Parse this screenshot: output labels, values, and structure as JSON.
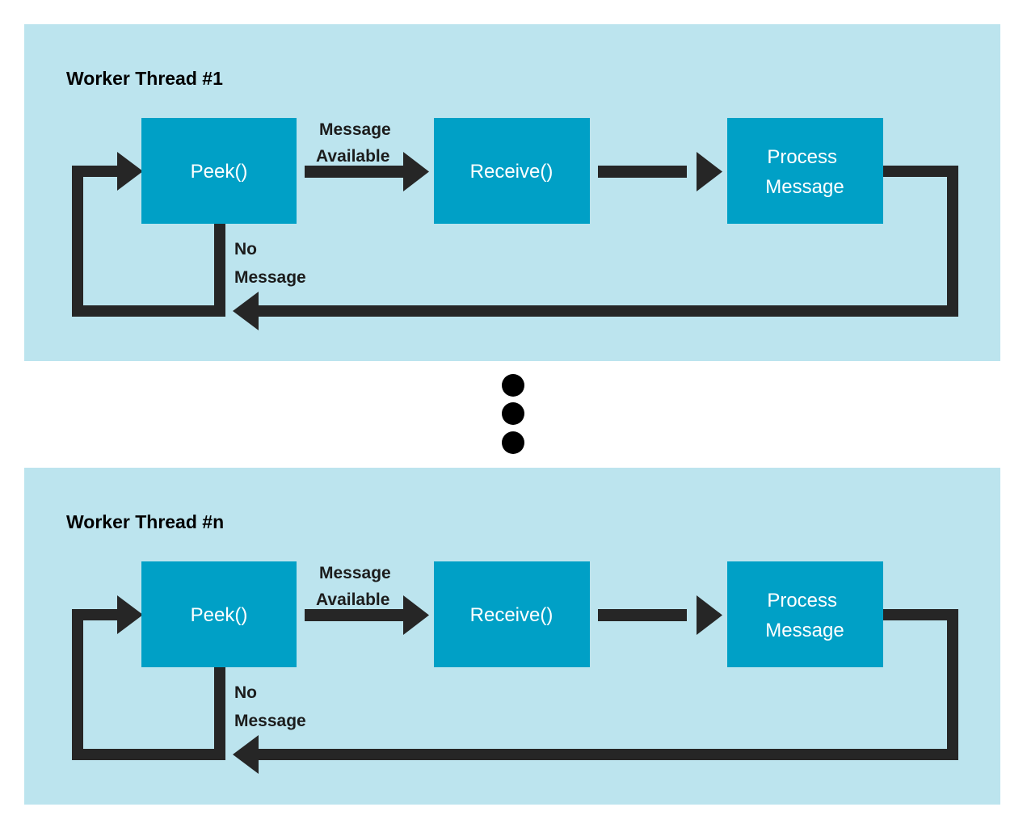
{
  "figure": {
    "kind": "flow-diagram",
    "background": "#ffffff",
    "panel_fill": "#bce4ee",
    "box_fill": "#00a0c6",
    "box_text_color": "#ffffff",
    "arrow_color": "#262626",
    "title_color": "#000000",
    "label_color": "#1c1c1c"
  },
  "panels": [
    {
      "id": "worker-thread-1",
      "title": "Worker Thread #1",
      "nodes": [
        {
          "id": "peek",
          "label": "Peek()",
          "lines": [
            "Peek()"
          ]
        },
        {
          "id": "receive",
          "label": "Receive()",
          "lines": [
            "Receive()"
          ]
        },
        {
          "id": "process",
          "label": "Process Message",
          "lines": [
            "Process",
            "Message"
          ]
        }
      ],
      "edges": [
        {
          "id": "peek-to-receive",
          "from": "peek",
          "to": "receive",
          "label": "Message Available",
          "label_lines": [
            "Message",
            "Available"
          ]
        },
        {
          "id": "receive-to-process",
          "from": "receive",
          "to": "process",
          "label": ""
        },
        {
          "id": "process-to-peek",
          "from": "process",
          "to": "peek",
          "label": ""
        },
        {
          "id": "peek-no-message-loop",
          "from": "peek",
          "to": "peek",
          "label": "No Message",
          "label_lines": [
            "No",
            "Message"
          ]
        }
      ]
    },
    {
      "id": "worker-thread-n",
      "title": "Worker Thread #n",
      "nodes": [
        {
          "id": "peek",
          "label": "Peek()",
          "lines": [
            "Peek()"
          ]
        },
        {
          "id": "receive",
          "label": "Receive()",
          "lines": [
            "Receive()"
          ]
        },
        {
          "id": "process",
          "label": "Process Message",
          "lines": [
            "Process",
            "Message"
          ]
        }
      ],
      "edges": [
        {
          "id": "peek-to-receive",
          "from": "peek",
          "to": "receive",
          "label": "Message Available",
          "label_lines": [
            "Message",
            "Available"
          ]
        },
        {
          "id": "receive-to-process",
          "from": "receive",
          "to": "process",
          "label": ""
        },
        {
          "id": "process-to-peek",
          "from": "process",
          "to": "peek",
          "label": ""
        },
        {
          "id": "peek-no-message-loop",
          "from": "peek",
          "to": "peek",
          "label": "No Message",
          "label_lines": [
            "No",
            "Message"
          ]
        }
      ]
    }
  ],
  "ellipsis": {
    "id": "vertical-ellipsis",
    "meaning": "additional worker threads omitted",
    "dot_count": 3,
    "color": "#000000"
  }
}
